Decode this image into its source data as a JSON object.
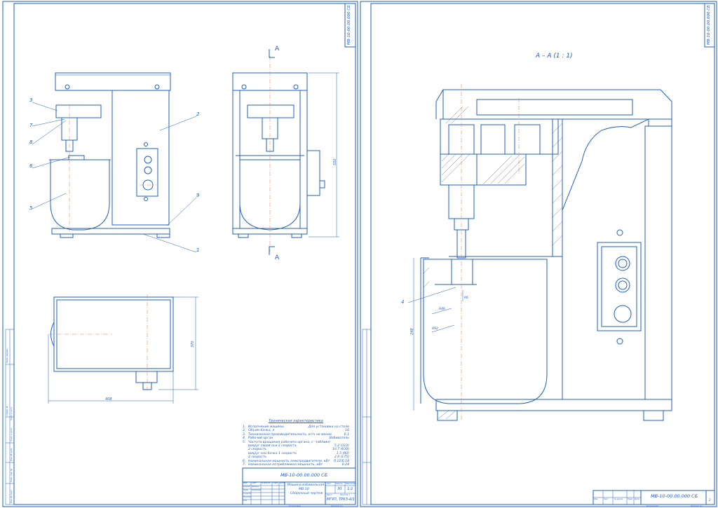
{
  "sheet_left": {
    "stamp_code": "МВ-10-00.00.000 СБ",
    "title_block": {
      "designation": "МВ-10-00.00.000 СБ",
      "name_line1": "Машина взбивальная",
      "name_line2": "МВ-10",
      "name_line3": "Сборочный чертеж",
      "mass": "30",
      "scale": "1:2",
      "org": "МГУП, ТРКЗ-4/1",
      "col_headers": [
        "Лит.",
        "Масса",
        "Масштаб"
      ],
      "sign_rows": [
        "Разраб.",
        "Пров.",
        "Т.контр.",
        "Н.контр.",
        "Утв."
      ],
      "sign_names": [
        "Демина",
        "Бобровой"
      ],
      "sign_head": [
        "Изм.",
        "Лист",
        "№ докум.",
        "Подп.",
        "Дата"
      ],
      "sheet_label": "Лист",
      "sheets_label": "Листов 1",
      "copied": "Копировал",
      "format": "Формат А1"
    },
    "side_strip": [
      "Перв. примен.",
      "Справ. №",
      "Подп. и дата",
      "Инв. № дубл.",
      "Взам. инв. №",
      "Подп. и дата",
      "Инв. № подл."
    ],
    "view_label_top": "А",
    "view_label_bottom": "А",
    "callouts": [
      "1",
      "2",
      "3",
      "4",
      "5",
      "6",
      "7",
      "8",
      "9"
    ],
    "dim_height": "550",
    "dim_width": "408",
    "dim_depth": "370",
    "specs": {
      "title": "Техническая характеристика",
      "rows": [
        {
          "n": "1.",
          "label": "Исполнение машины",
          "value": "Для установки на столе"
        },
        {
          "n": "2.",
          "label": "Объем бачка, л",
          "value": "10"
        },
        {
          "n": "3.",
          "label": "Техническая производительность, кг/ч не менее",
          "value": "6,1"
        },
        {
          "n": "4.",
          "label": "Рабочий орган",
          "value": "Взбиватель"
        },
        {
          "n": "5.",
          "label": "Частота вращения рабочего органа, с⁻¹(об/мин)",
          "value": ""
        },
        {
          "n": "",
          "label": "вокруг своей оси    1 скорость",
          "value": "5,2 (313)"
        },
        {
          "n": "",
          "label": "                    2 скорость",
          "value": "10,7 (639)"
        },
        {
          "n": "",
          "label": "вокруг оси бачка    1 скорость",
          "value": "1,5 (90)"
        },
        {
          "n": "",
          "label": "                    2 скорость",
          "value": "2,9 (175)"
        },
        {
          "n": "6.",
          "label": "Номинальная мощность электродвигателя, кВт",
          "value": "0,12/0,18"
        },
        {
          "n": "7.",
          "label": "Номинальная потребляемая мощность, кВт",
          "value": "0,24"
        }
      ]
    }
  },
  "sheet_right": {
    "section_title": "А – А (1 : 1)",
    "stamp_code": "МВ-10-00.00.000 СБ",
    "title_block": {
      "designation": "МВ-10-00.00.000 СБ",
      "sheet": "2",
      "sign_head": [
        "Изм.",
        "Лист",
        "№ докум.",
        "Подп.",
        "Дата"
      ],
      "copied": "Копировал",
      "format": "Формат А1"
    },
    "callout_4": "4",
    "dim_R46": "R46",
    "dim_R6": "R6",
    "dim_R92": "R92",
    "dim_248": "248"
  }
}
